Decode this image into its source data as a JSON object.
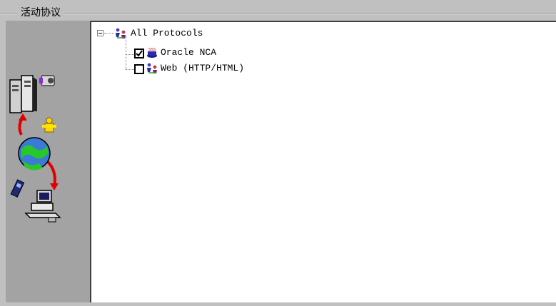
{
  "group": {
    "title": "活动协议"
  },
  "tree": {
    "root": {
      "label": "All Protocols",
      "icon": "network-users-icon",
      "expanded": true
    },
    "items": [
      {
        "label": "Oracle NCA",
        "checked": true,
        "icon": "oracle-icon"
      },
      {
        "label": "Web (HTTP/HTML)",
        "checked": false,
        "icon": "web-protocol-icon"
      }
    ]
  },
  "illustration": {
    "icons": [
      "server-icon",
      "camera-icon",
      "user-icon",
      "globe-icon",
      "mobile-phone-icon",
      "workstation-icon"
    ]
  },
  "colors": {
    "panel": "#c0c0c0",
    "illustration_bg": "#a3a3a3",
    "tree_bg": "#ffffff",
    "arrow": "#e00000"
  }
}
